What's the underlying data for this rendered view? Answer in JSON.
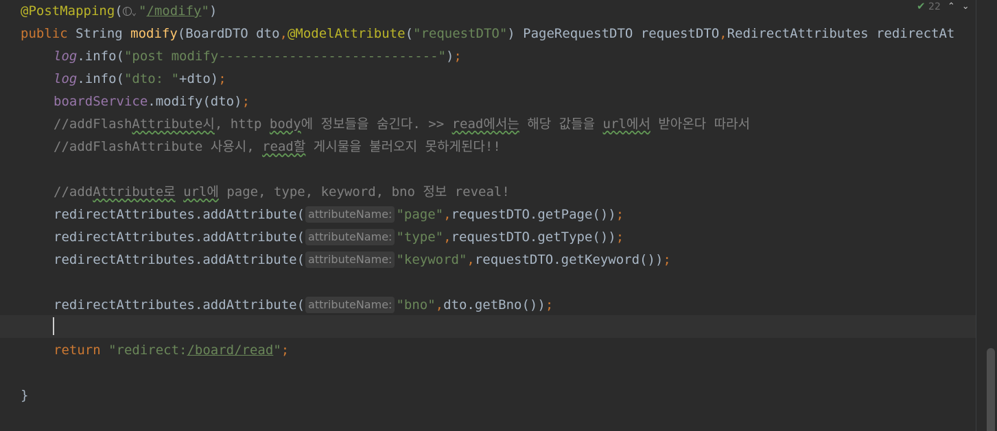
{
  "editor": {
    "line1": {
      "ann": "@PostMapping",
      "paren": "(",
      "hint_icon": "globe-icon",
      "hint_chev": "⌄",
      "str": "\"/modify\"",
      "close": ")"
    },
    "line2": {
      "kw": "public",
      "type": " String ",
      "fn": "modify",
      "p1": "(BoardDTO dto",
      "comma1": ",",
      "ann": "@ModelAttribute",
      "p2": "(",
      "str": "\"requestDTO\"",
      "p3": ") PageRequestDTO requestDTO",
      "comma2": ",",
      "p4": "RedirectAttributes redirectAt"
    },
    "line3": {
      "obj": "log",
      "call": ".info(",
      "str": "\"post modify----------------------------\"",
      "end": ")",
      "semi": ";"
    },
    "line4": {
      "obj": "log",
      "call": ".info(",
      "str": "\"dto: \"",
      "rest": "+dto)",
      "semi": ";"
    },
    "line5": {
      "obj": "boardService",
      "call": ".modify(dto)",
      "semi": ";"
    },
    "line6": {
      "a": "//addFlash",
      "b": "Attribute시",
      "c": ", http ",
      "d": "body",
      "e": "에 정보들을 숨긴다. >> ",
      "f": "read에서는",
      "g": " 해당 값들을 ",
      "h": "url에서",
      "i": " 받아온다 따라서"
    },
    "line7": {
      "a": "//addFlashAttribute 사용시, ",
      "b": "read할",
      "c": " 게시물을 불러오지 못하게된다!!"
    },
    "line9": {
      "a": "//add",
      "b": "Attribute로",
      "c": " ",
      "d": "url에",
      "e": " page, type, keyword, bno 정보 reveal!"
    },
    "line10": {
      "call": "redirectAttributes.addAttribute(",
      "hint": "attributeName:",
      "str": "\"page\"",
      "comma": ",",
      "rest": "requestDTO.getPage())",
      "semi": ";"
    },
    "line11": {
      "call": "redirectAttributes.addAttribute(",
      "hint": "attributeName:",
      "str": "\"type\"",
      "comma": ",",
      "rest": "requestDTO.getType())",
      "semi": ";"
    },
    "line12": {
      "call": "redirectAttributes.addAttribute(",
      "hint": "attributeName:",
      "str": "\"keyword\"",
      "comma": ",",
      "rest": "requestDTO.getKeyword())",
      "semi": ";"
    },
    "line14": {
      "call": "redirectAttributes.addAttribute(",
      "hint": "attributeName:",
      "str": "\"bno\"",
      "comma": ",",
      "rest": "dto.getBno())",
      "semi": ";"
    },
    "line16": {
      "kw": "return",
      "sp": " ",
      "q1": "\"redirect:",
      "path": "/board/read",
      "q2": "\"",
      "semi": ";"
    },
    "line18": {
      "brace": "}"
    }
  },
  "inspection": {
    "count": "22",
    "up": "⌃",
    "down": "⌄"
  }
}
